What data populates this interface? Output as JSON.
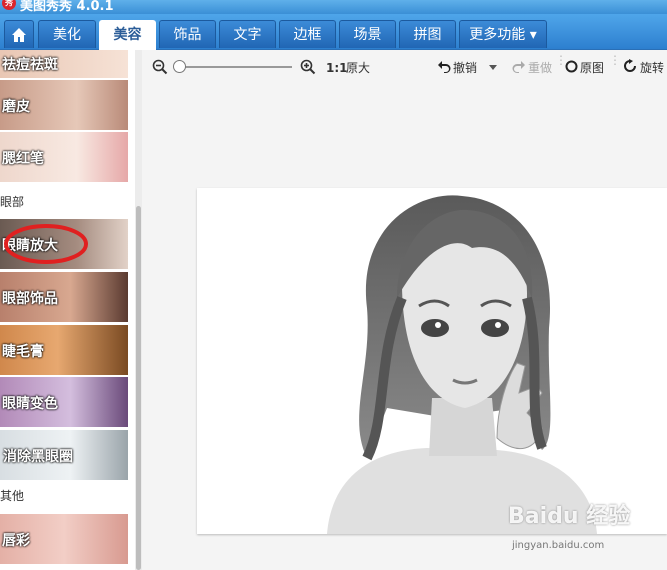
{
  "app": {
    "title": "美图秀秀 4.0.1",
    "logo_text": "秀"
  },
  "tabs": [
    {
      "label": "美化"
    },
    {
      "label": "美容"
    },
    {
      "label": "饰品"
    },
    {
      "label": "文字"
    },
    {
      "label": "边框"
    },
    {
      "label": "场景"
    },
    {
      "label": "拼图"
    },
    {
      "label": "更多功能 ▾"
    }
  ],
  "toolbar": {
    "zoom_ratio": "1:1",
    "original_size": "原大",
    "undo": "撤销",
    "redo": "重做",
    "original": "原图",
    "rotate": "旋转"
  },
  "sidebar": {
    "items_top": [
      {
        "label": "祛痘祛斑"
      },
      {
        "label": "磨皮"
      },
      {
        "label": "腮红笔"
      }
    ],
    "section_eyes": "眼部",
    "items_eyes": [
      {
        "label": "眼睛放大"
      },
      {
        "label": "眼部饰品"
      },
      {
        "label": "睫毛膏"
      },
      {
        "label": "眼睛变色"
      },
      {
        "label": "消除黑眼圈"
      }
    ],
    "section_other": "其他",
    "items_other": [
      {
        "label": "唇彩"
      }
    ]
  },
  "watermark": {
    "brand": "Baidu 经验",
    "url": "jingyan.baidu.com"
  },
  "colors": {
    "title_bar": "#4a9fe5",
    "tab_bar": "#3d8ede",
    "active_tab": "#ffffff",
    "highlight": "#e02020"
  }
}
